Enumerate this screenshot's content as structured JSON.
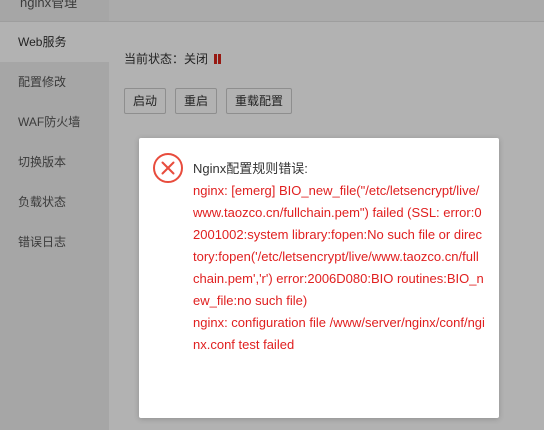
{
  "app": {
    "title": "nginx管理"
  },
  "sidebar": {
    "items": [
      {
        "label": "Web服务",
        "active": true
      },
      {
        "label": "配置修改",
        "active": false
      },
      {
        "label": "WAF防火墙",
        "active": false
      },
      {
        "label": "切换版本",
        "active": false
      },
      {
        "label": "负载状态",
        "active": false
      },
      {
        "label": "错误日志",
        "active": false
      }
    ]
  },
  "main": {
    "status_label": "当前状态：关闭",
    "status_icon": "pause-icon",
    "status_color": "#d9241b",
    "buttons": {
      "start": "启动",
      "restart": "重启",
      "reload": "重载配置"
    }
  },
  "dialog": {
    "icon": "error-circle-icon",
    "icon_color": "#e84c3d",
    "heading": "Nginx配置规则错误:",
    "error_lines": [
      "nginx: [emerg] BIO_new_file(\"/etc/letsencrypt/live/www.taozco.cn/fullchain.pem\") failed (SSL: error:02001002:system library:fopen:No such file or directory:fopen('/etc/letsencrypt/live/www.taozco.cn/fullchain.pem','r') error:2006D080:BIO routines:BIO_new_file:no such file)",
      "nginx: configuration file /www/server/nginx/conf/nginx.conf test failed"
    ],
    "error_color": "#e02020"
  }
}
